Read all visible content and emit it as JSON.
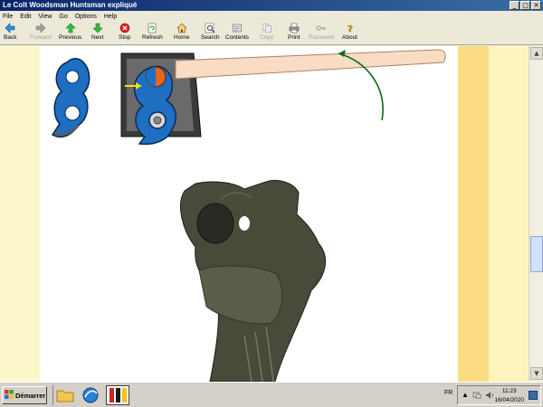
{
  "window": {
    "title": "Le Colt Woodsman Huntsman expliqué"
  },
  "menu": [
    "File",
    "Edit",
    "View",
    "Go",
    "Options",
    "Help"
  ],
  "toolbar": {
    "back": "Back",
    "forward": "Forward",
    "previous": "Previous",
    "next": "Next",
    "stop": "Stop",
    "refresh": "Refresh",
    "home": "Home",
    "search": "Search",
    "contents": "Contents",
    "copy": "Copy",
    "print": "Print",
    "password": "Password",
    "about": "About"
  },
  "taskbar": {
    "start": "Démarrer",
    "language": "FR",
    "time": "11:23",
    "date": "16/04/2020"
  },
  "colors": {
    "accent_blue": "#1e6fc2",
    "orange": "#e8671a",
    "page_band": "#fcdc82"
  }
}
